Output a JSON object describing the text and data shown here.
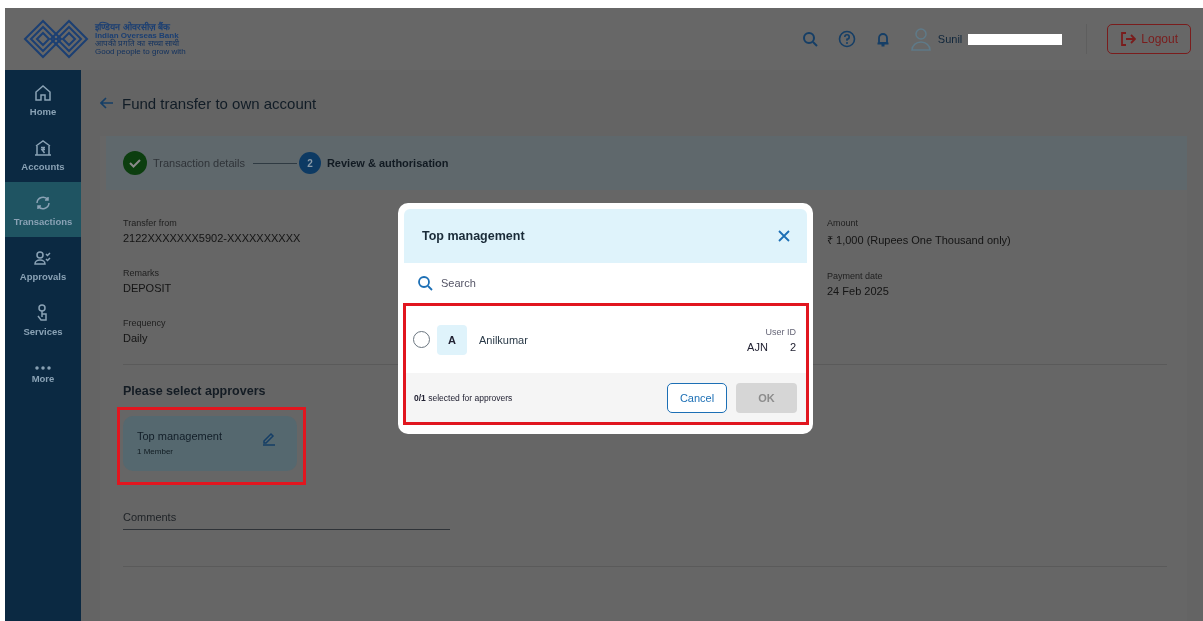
{
  "header": {
    "bank_name_hindi": "इण्डियन ओवरसीज़ बैंक",
    "bank_name": "Indian Overseas Bank",
    "tagline_hindi": "आपकी प्रगति का सच्चा साथी",
    "tagline": "Good people to grow with",
    "user_name": "Sunil",
    "logout": "Logout"
  },
  "sidebar": {
    "items": [
      {
        "label": "Home",
        "selected": false
      },
      {
        "label": "Accounts",
        "selected": false
      },
      {
        "label": "Transactions",
        "selected": true
      },
      {
        "label": "Approvals",
        "selected": false
      },
      {
        "label": "Services",
        "selected": false
      },
      {
        "label": "More",
        "selected": false
      }
    ]
  },
  "page": {
    "title": "Fund transfer to own account"
  },
  "stepper": [
    {
      "kind": "done",
      "label": "Transaction details"
    },
    {
      "kind": "current",
      "number": "2",
      "label": "Review & authorisation"
    }
  ],
  "details": {
    "left": [
      {
        "label": "Transfer from",
        "value": "2122XXXXXXX5902-XXXXXXXXXX"
      },
      {
        "label": "Remarks",
        "value": "DEPOSIT"
      },
      {
        "label": "Frequency",
        "value": "Daily"
      }
    ],
    "right": [
      {
        "label": "Amount",
        "value": "₹ 1,000 (Rupees One Thousand only)"
      },
      {
        "label": "Payment date",
        "value": "24 Feb 2025"
      }
    ]
  },
  "approvers": {
    "heading": "Please select approvers",
    "groups": [
      {
        "name": "Top management",
        "members": "1 Member"
      }
    ]
  },
  "comments": {
    "placeholder": "Comments"
  },
  "modal": {
    "title": "Top management",
    "search_placeholder": "Search",
    "members": [
      {
        "initial": "A",
        "name": "Anilkumar",
        "id_label": "User ID",
        "id_prefix": "AJN",
        "id_suffix": "2",
        "selected": false
      }
    ],
    "footer": "**0/1** selected for approvers",
    "cancel": "Cancel",
    "ok": "OK",
    "ok_disabled": true
  }
}
